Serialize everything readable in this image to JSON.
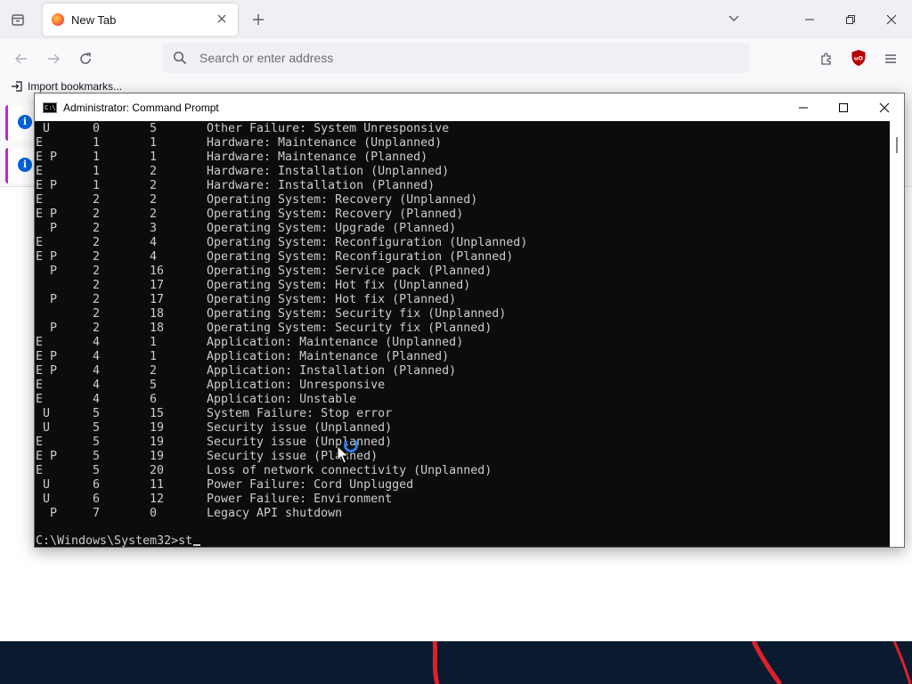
{
  "browser": {
    "tab_title": "New Tab",
    "address_placeholder": "Search or enter address",
    "bookmarks_import_label": "Import bookmarks...",
    "accent_color": "#0061e0"
  },
  "cmd": {
    "title": "Administrator: Command Prompt",
    "rows": [
      {
        "flag": " U",
        "major": "0",
        "minor": "5",
        "desc": "Other Failure: System Unresponsive"
      },
      {
        "flag": "E",
        "major": "1",
        "minor": "1",
        "desc": "Hardware: Maintenance (Unplanned)"
      },
      {
        "flag": "E P",
        "major": "1",
        "minor": "1",
        "desc": "Hardware: Maintenance (Planned)"
      },
      {
        "flag": "E",
        "major": "1",
        "minor": "2",
        "desc": "Hardware: Installation (Unplanned)"
      },
      {
        "flag": "E P",
        "major": "1",
        "minor": "2",
        "desc": "Hardware: Installation (Planned)"
      },
      {
        "flag": "E",
        "major": "2",
        "minor": "2",
        "desc": "Operating System: Recovery (Unplanned)"
      },
      {
        "flag": "E P",
        "major": "2",
        "minor": "2",
        "desc": "Operating System: Recovery (Planned)"
      },
      {
        "flag": "  P",
        "major": "2",
        "minor": "3",
        "desc": "Operating System: Upgrade (Planned)"
      },
      {
        "flag": "E",
        "major": "2",
        "minor": "4",
        "desc": "Operating System: Reconfiguration (Unplanned)"
      },
      {
        "flag": "E P",
        "major": "2",
        "minor": "4",
        "desc": "Operating System: Reconfiguration (Planned)"
      },
      {
        "flag": "  P",
        "major": "2",
        "minor": "16",
        "desc": "Operating System: Service pack (Planned)"
      },
      {
        "flag": "",
        "major": "2",
        "minor": "17",
        "desc": "Operating System: Hot fix (Unplanned)"
      },
      {
        "flag": "  P",
        "major": "2",
        "minor": "17",
        "desc": "Operating System: Hot fix (Planned)"
      },
      {
        "flag": "",
        "major": "2",
        "minor": "18",
        "desc": "Operating System: Security fix (Unplanned)"
      },
      {
        "flag": "  P",
        "major": "2",
        "minor": "18",
        "desc": "Operating System: Security fix (Planned)"
      },
      {
        "flag": "E",
        "major": "4",
        "minor": "1",
        "desc": "Application: Maintenance (Unplanned)"
      },
      {
        "flag": "E P",
        "major": "4",
        "minor": "1",
        "desc": "Application: Maintenance (Planned)"
      },
      {
        "flag": "E P",
        "major": "4",
        "minor": "2",
        "desc": "Application: Installation (Planned)"
      },
      {
        "flag": "E",
        "major": "4",
        "minor": "5",
        "desc": "Application: Unresponsive"
      },
      {
        "flag": "E",
        "major": "4",
        "minor": "6",
        "desc": "Application: Unstable"
      },
      {
        "flag": " U",
        "major": "5",
        "minor": "15",
        "desc": "System Failure: Stop error"
      },
      {
        "flag": " U",
        "major": "5",
        "minor": "19",
        "desc": "Security issue (Unplanned)"
      },
      {
        "flag": "E",
        "major": "5",
        "minor": "19",
        "desc": "Security issue (Unplanned)"
      },
      {
        "flag": "E P",
        "major": "5",
        "minor": "19",
        "desc": "Security issue (Planned)"
      },
      {
        "flag": "E",
        "major": "5",
        "minor": "20",
        "desc": "Loss of network connectivity (Unplanned)"
      },
      {
        "flag": " U",
        "major": "6",
        "minor": "11",
        "desc": "Power Failure: Cord Unplugged"
      },
      {
        "flag": " U",
        "major": "6",
        "minor": "12",
        "desc": "Power Failure: Environment"
      },
      {
        "flag": "  P",
        "major": "7",
        "minor": "0",
        "desc": "Legacy API shutdown"
      }
    ],
    "prompt": "C:\\Windows\\System32>st"
  }
}
